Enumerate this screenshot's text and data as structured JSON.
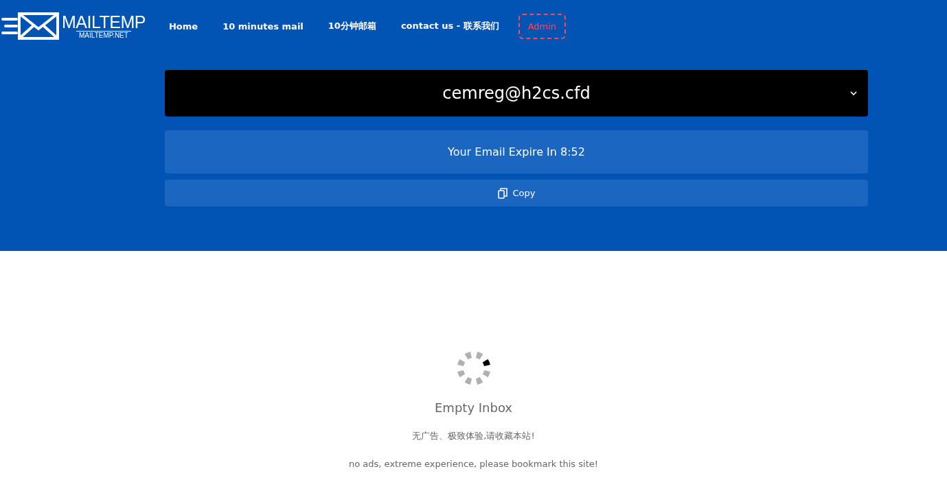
{
  "logo": {
    "title": "MAILTEMP",
    "subtitle": "MAILTEMP.NET"
  },
  "nav": [
    {
      "label": "Home",
      "kind": "link"
    },
    {
      "label": "10 minutes mail",
      "kind": "link"
    },
    {
      "label": "10分钟邮箱",
      "kind": "link"
    },
    {
      "label": "contact us - 联系我们",
      "kind": "link"
    },
    {
      "label": "Admin",
      "kind": "outlined"
    }
  ],
  "email_select": {
    "value": "cemreg@h2cs.cfd"
  },
  "expiry": "Your Email Expire In 8:52",
  "copy_button": "Copy",
  "inbox": {
    "status": "Empty Inbox",
    "note_zh": "无广告、极致体验,请收藏本站!",
    "note_en": "no ads, extreme experience, please bookmark this site!"
  }
}
